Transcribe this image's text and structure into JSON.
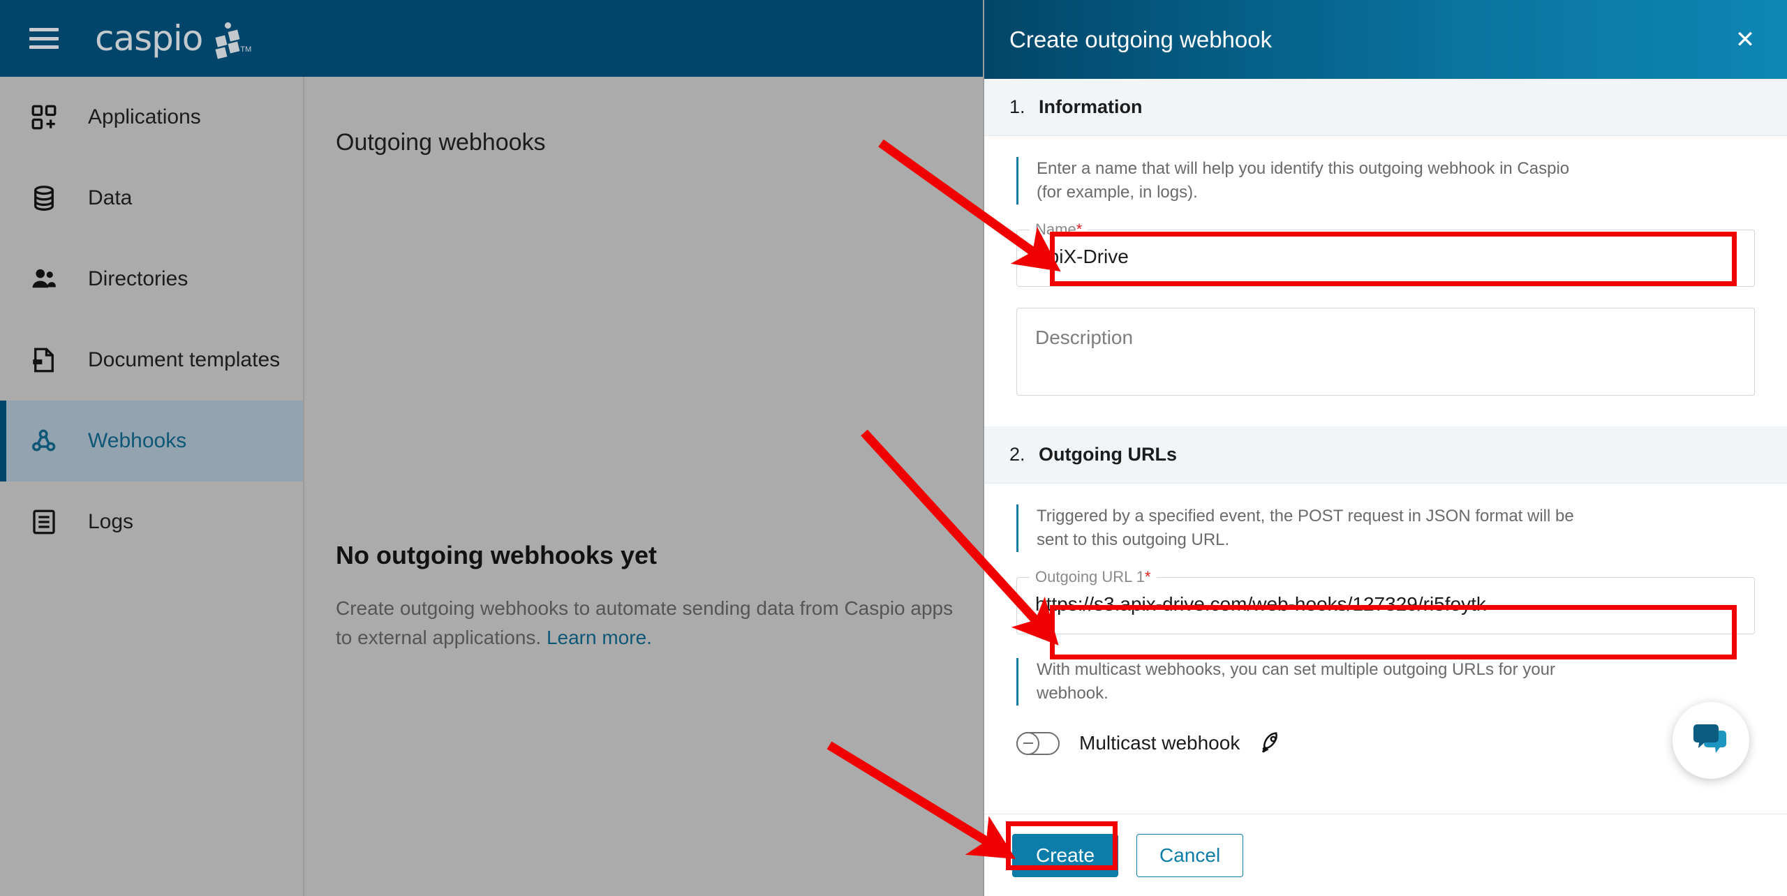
{
  "brand": {
    "name": "caspio",
    "tm": "TM"
  },
  "topbar": {
    "menu_icon": "hamburger-menu-icon"
  },
  "sidebar": {
    "items": [
      {
        "label": "Applications",
        "icon": "apps-grid-icon",
        "active": false
      },
      {
        "label": "Data",
        "icon": "database-icon",
        "active": false
      },
      {
        "label": "Directories",
        "icon": "users-icon",
        "active": false
      },
      {
        "label": "Document templates",
        "icon": "document-icon",
        "active": false
      },
      {
        "label": "Webhooks",
        "icon": "webhook-icon",
        "active": true
      },
      {
        "label": "Logs",
        "icon": "log-list-icon",
        "active": false
      }
    ]
  },
  "main": {
    "page_title": "Outgoing webhooks",
    "empty_state": {
      "title": "No outgoing webhooks yet",
      "description": "Create outgoing webhooks to automate sending data from Caspio apps to external applications.",
      "link": "Learn more."
    }
  },
  "panel": {
    "title": "Create outgoing webhook",
    "close_icon": "close-icon",
    "sections": [
      {
        "number": "1.",
        "name": "Information"
      },
      {
        "number": "2.",
        "name": "Outgoing URLs"
      }
    ],
    "information": {
      "hint": "Enter a name that will help you identify this outgoing webhook in Caspio (for example, in logs).",
      "name_field": {
        "label": "Name",
        "required_mark": "*",
        "value": "ApiX-Drive"
      },
      "description_field": {
        "placeholder": "Description",
        "value": ""
      }
    },
    "outgoing_urls": {
      "hint": "Triggered by a specified event, the POST request in JSON format will be sent to this outgoing URL.",
      "url_field": {
        "label": "Outgoing URL 1",
        "required_mark": "*",
        "value": "https://s3.apix-drive.com/web-hooks/127329/ri5foytk"
      },
      "multicast_hint": "With multicast webhooks, you can set multiple outgoing URLs for your webhook.",
      "multicast_toggle": {
        "label": "Multicast webhook",
        "state": "off",
        "icon": "rocket-icon"
      }
    },
    "footer": {
      "create_label": "Create",
      "cancel_label": "Cancel"
    }
  },
  "chat_widget": {
    "icon": "chat-bubbles-icon"
  },
  "colors": {
    "brand_dark": "#02456b",
    "accent": "#0b7da8",
    "sidebar_bg": "#ababab",
    "annotation_red": "#f00000",
    "active_nav_bg": "#93a3b0"
  }
}
